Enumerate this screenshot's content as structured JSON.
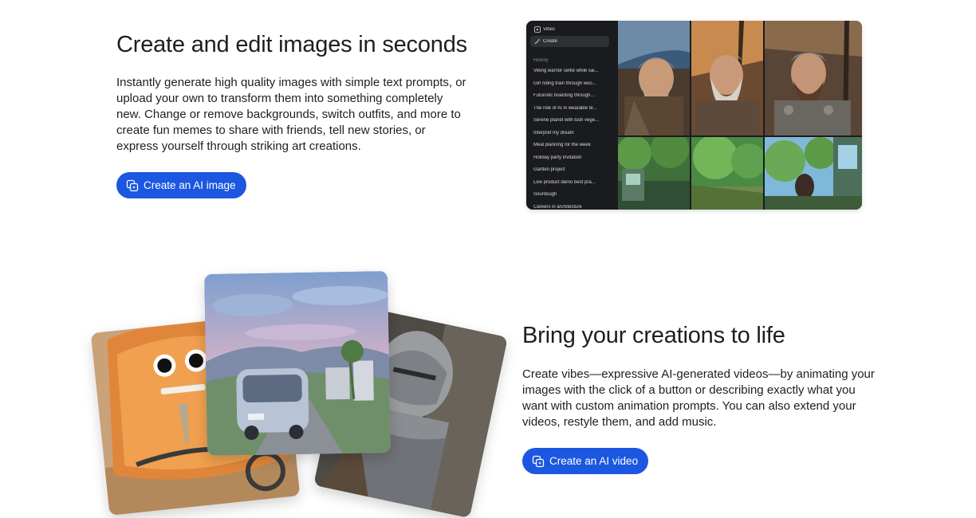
{
  "section_images": {
    "title": "Create and edit images in seconds",
    "body": "Instantly generate high quality images with simple text prompts, or upload your own to transform them into something completely new. Change or remove backgrounds, switch outfits, and more to create fun memes to share with friends, tell new stories, or express yourself through striking art creations.",
    "button_label": "Create an AI image",
    "button_icon": "image-sparkle-icon"
  },
  "app_preview": {
    "app_name": "Vibes",
    "create_label": "Create",
    "history_label": "History",
    "history_items": [
      "Viking warrior selfie while sai...",
      "Girl riding train through woo...",
      "Futuristic boarding through...",
      "The role of AI in wearable te...",
      "Serene planet with lush vege...",
      "Interpret my dream",
      "Meal planning for the week",
      "Holiday party invitation",
      "Garden project",
      "Live product demo best pra...",
      "Sourdough",
      "Careers in architecture"
    ]
  },
  "section_videos": {
    "title": "Bring your creations to life",
    "body": "Create vibes—expressive AI-generated videos—by animating your images with the click of a button or describing exactly what you want with custom animation prompts. You can also extend your videos, restyle them, and add music.",
    "button_label": "Create an AI video",
    "button_icon": "video-sparkle-icon"
  },
  "colors": {
    "accent": "#1b57e0",
    "text": "#1c1e21",
    "background": "#ffffff",
    "mock_bg": "#1b1c1f"
  }
}
